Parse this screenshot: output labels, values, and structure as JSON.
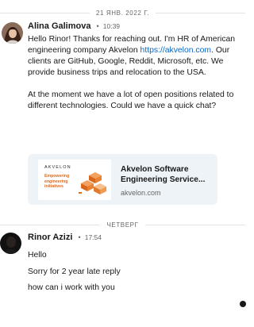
{
  "date_separators": [
    "21 ЯНВ. 2022 Г.",
    "ЧЕТВЕРГ"
  ],
  "messages": [
    {
      "sender": "Alina Galimova",
      "time": "10:39",
      "intro": "Hello Rinor! Thanks for reaching out. I'm HR of American engineering company",
      "company": "Akvelon ",
      "url": "https://akvelon.com",
      "after_url": ". Our clients are GitHub, Google, Reddit, Microsoft, etc. We provide business trips and relocation to the USA.",
      "para2": "At the moment we have a lot of open positions related to different technologies. Could we have a quick chat?",
      "link_preview": {
        "brand": "AKVELON",
        "tagline": "Empowering engineering initiatives",
        "title_line1": "Akvelon Software",
        "title_line2": "Engineering Service...",
        "domain": "akvelon.com"
      }
    },
    {
      "sender": "Rinor Azizi",
      "time": "17:54",
      "lines": [
        "Hello",
        "Sorry for 2 year late reply",
        "how can i work with you"
      ]
    }
  ],
  "colors": {
    "link": "#0a66c2",
    "preview_bg": "#eef3f8",
    "accent_orange": "#e06a1b",
    "muted": "#666666"
  }
}
